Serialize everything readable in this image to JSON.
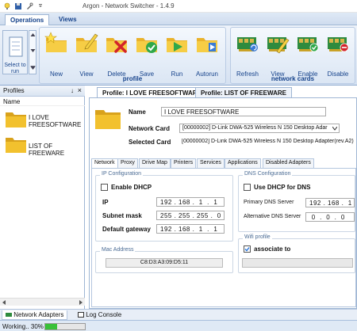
{
  "window": {
    "title": "Argon - Network Switcher - 1.4.9",
    "quick_access": [
      "app-icon",
      "save-icon",
      "tool-icon",
      "customize-icon"
    ]
  },
  "ribbon_tabs": [
    {
      "label": "Operations",
      "active": true
    },
    {
      "label": "Views",
      "active": false
    }
  ],
  "ribbon": {
    "select_to_run": "Select to run",
    "profile_group": {
      "label": "profile",
      "buttons": [
        {
          "label": "New",
          "icon": "new-profile-icon"
        },
        {
          "label": "View",
          "icon": "view-profile-icon"
        },
        {
          "label": "Delete",
          "icon": "delete-profile-icon"
        },
        {
          "label": "Save",
          "icon": "save-profile-icon"
        },
        {
          "label": "Run",
          "icon": "run-profile-icon"
        },
        {
          "label": "Autorun",
          "icon": "autorun-icon"
        }
      ]
    },
    "network_cards_group": {
      "label": "network cards",
      "buttons": [
        {
          "label": "Refresh",
          "icon": "refresh-card-icon"
        },
        {
          "label": "View",
          "icon": "view-card-icon"
        },
        {
          "label": "Enable",
          "icon": "enable-card-icon"
        },
        {
          "label": "Disable",
          "icon": "disable-card-icon"
        }
      ]
    }
  },
  "profiles_panel": {
    "title": "Profiles",
    "pin": "↓",
    "close": "×",
    "column": "Name",
    "items": [
      {
        "line1": "I LOVE",
        "line2": "FREESOFTWARE"
      },
      {
        "line1": "LIST OF FREEWARE",
        "line2": ""
      }
    ]
  },
  "editor": {
    "tabs": [
      "Profile: I LOVE FREESOFTWARE",
      "Profile: LIST OF FREEWARE"
    ],
    "name_label": "Name",
    "name_value": "I LOVE FREESOFTWARE",
    "network_card_label": "Network Card",
    "network_card_value": "[00000002] D-Link DWA-525 Wireless N 150 Desktop Adar",
    "selected_card_label": "Selected Card",
    "selected_card_value": "[00000002] D-Link DWA-525 Wireless N 150 Desktop Adapter(rev.A2)",
    "sub_tabs": [
      "Network",
      "Proxy",
      "Drive Map",
      "Printers",
      "Services",
      "Applications",
      "Disabled Adapters"
    ],
    "ip_config": {
      "title": "IP Configuration",
      "enable_dhcp": "Enable DHCP",
      "ip_label": "IP",
      "ip_value": "192 . 168 .  1  .  1",
      "subnet_label": "Subnet mask",
      "subnet_value": "255 . 255 . 255 .  0",
      "gateway_label": "Default gateway",
      "gateway_value": "192 . 168 .  1  .  1"
    },
    "dns_config": {
      "title": "DNS Configuration",
      "use_dhcp_dns": "Use DHCP for DNS",
      "primary_label": "Primary DNS Server",
      "primary_value": "192 . 168 .  1",
      "alt_label": "Alternative DNS Server",
      "alt_value": " 0  .  0  .  0"
    },
    "mac": {
      "title": "Mac Address",
      "value": "C8:D3:A3:09:D5:11"
    },
    "wifi": {
      "title": "Wifi profile",
      "associate": "associate to",
      "checked": true
    }
  },
  "bottom_tabs": [
    "Network Adapters",
    "Log Console"
  ],
  "status": {
    "text": "Working.. 30%",
    "progress": 0.3
  },
  "colors": {
    "accent": "#15428b",
    "progress": "#39c139",
    "folder": "#f2c12e"
  }
}
